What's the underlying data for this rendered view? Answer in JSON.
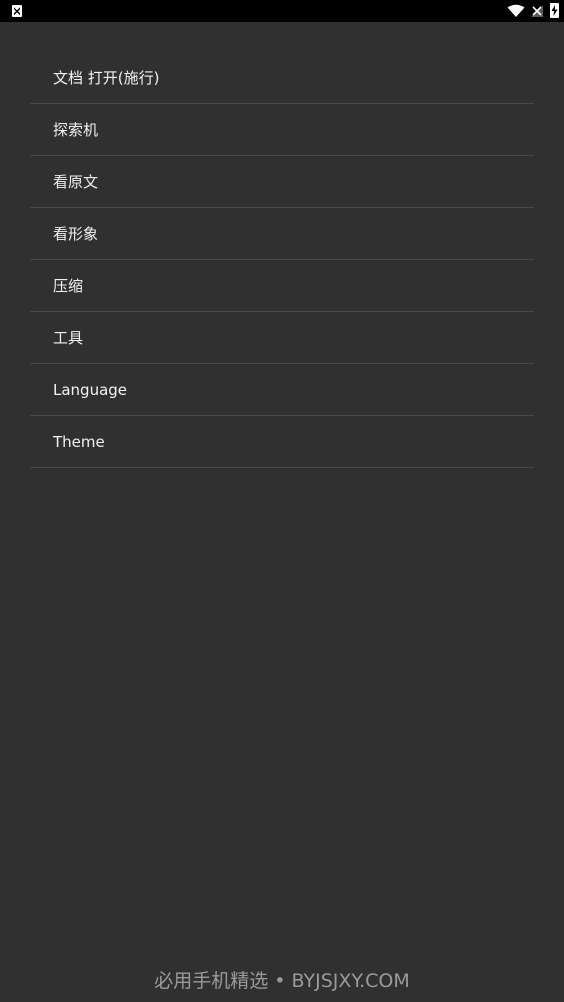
{
  "status_bar": {
    "left_icon": "app-notification-icon",
    "right_icons": [
      "wifi-icon",
      "signal-icon",
      "battery-charging-icon"
    ]
  },
  "menu": {
    "items": [
      {
        "label": "文档 打开(施行)"
      },
      {
        "label": "探索机"
      },
      {
        "label": "看原文"
      },
      {
        "label": "看形象"
      },
      {
        "label": "压缩"
      },
      {
        "label": "工具"
      },
      {
        "label": "Language"
      },
      {
        "label": "Theme"
      }
    ]
  },
  "watermark": {
    "text": "必用手机精选 • BYJSJXY.COM"
  },
  "colors": {
    "background": "#303030",
    "status_bar": "#000000",
    "divider": "#4a4a4a",
    "text": "#f2f2f2",
    "watermark": "#9a9a9a"
  }
}
